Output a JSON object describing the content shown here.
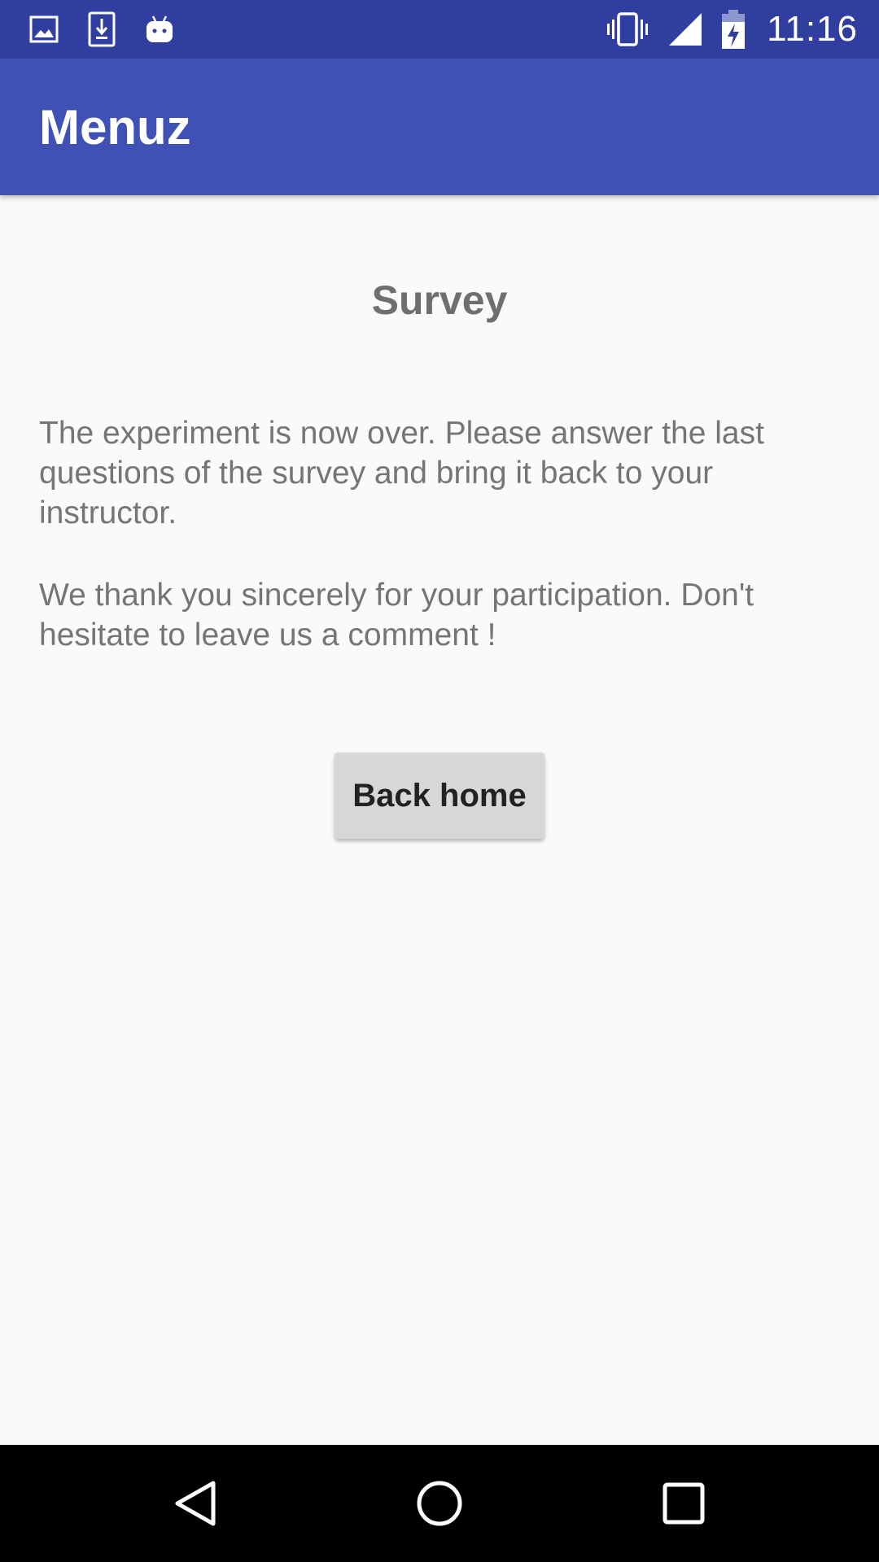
{
  "status_bar": {
    "left_icons": [
      "image-icon",
      "download-icon",
      "android-icon"
    ],
    "right_icons": [
      "vibrate-icon",
      "signal-icon",
      "battery-charging-icon"
    ],
    "time": "11:16",
    "background": "#303f9f"
  },
  "app_bar": {
    "title": "Menuz",
    "background": "#3f51b5"
  },
  "main": {
    "heading": "Survey",
    "paragraph_1": "The experiment is now over. Please answer the last questions of the survey and bring it back to your instructor.",
    "paragraph_2": "We thank you sincerely for your participation. Don't hesitate to leave us a comment !",
    "back_button_label": "Back home"
  },
  "nav_bar": {
    "buttons": [
      "back-icon",
      "home-icon",
      "recents-icon"
    ]
  }
}
